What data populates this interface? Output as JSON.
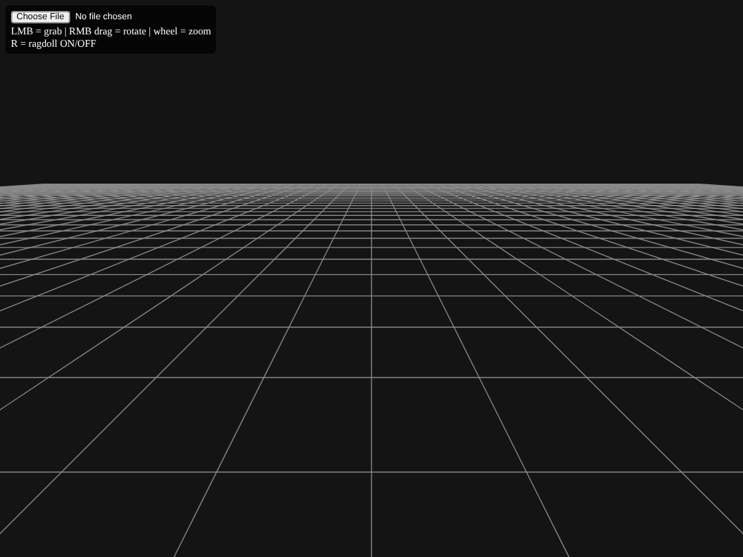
{
  "file_input": {
    "button": "Choose File",
    "status": "No file chosen"
  },
  "help_lines": [
    "LMB = grab | RMB drag = rotate | wheel = zoom",
    "R = ragdoll ON/OFF"
  ]
}
